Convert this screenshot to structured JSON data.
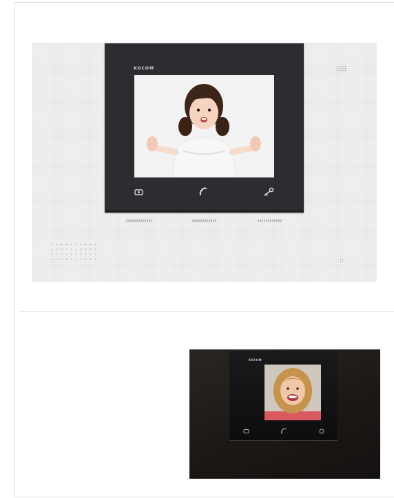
{
  "top_monitor": {
    "brand": "KOCOM",
    "buttons": [
      {
        "name": "monitor",
        "icon": "monitor-icon"
      },
      {
        "name": "talk",
        "icon": "handset-icon"
      },
      {
        "name": "door-open",
        "icon": "key-icon"
      }
    ]
  },
  "bottom_monitor": {
    "brand": "KOCOM",
    "buttons": [
      {
        "name": "monitor",
        "icon": "monitor-icon"
      },
      {
        "name": "talk",
        "icon": "handset-icon"
      },
      {
        "name": "door-open",
        "icon": "key-icon"
      }
    ]
  },
  "colors": {
    "white_panel": "#efefef",
    "bezel": "#2b2d30",
    "dark_panel": "#1d1816"
  }
}
